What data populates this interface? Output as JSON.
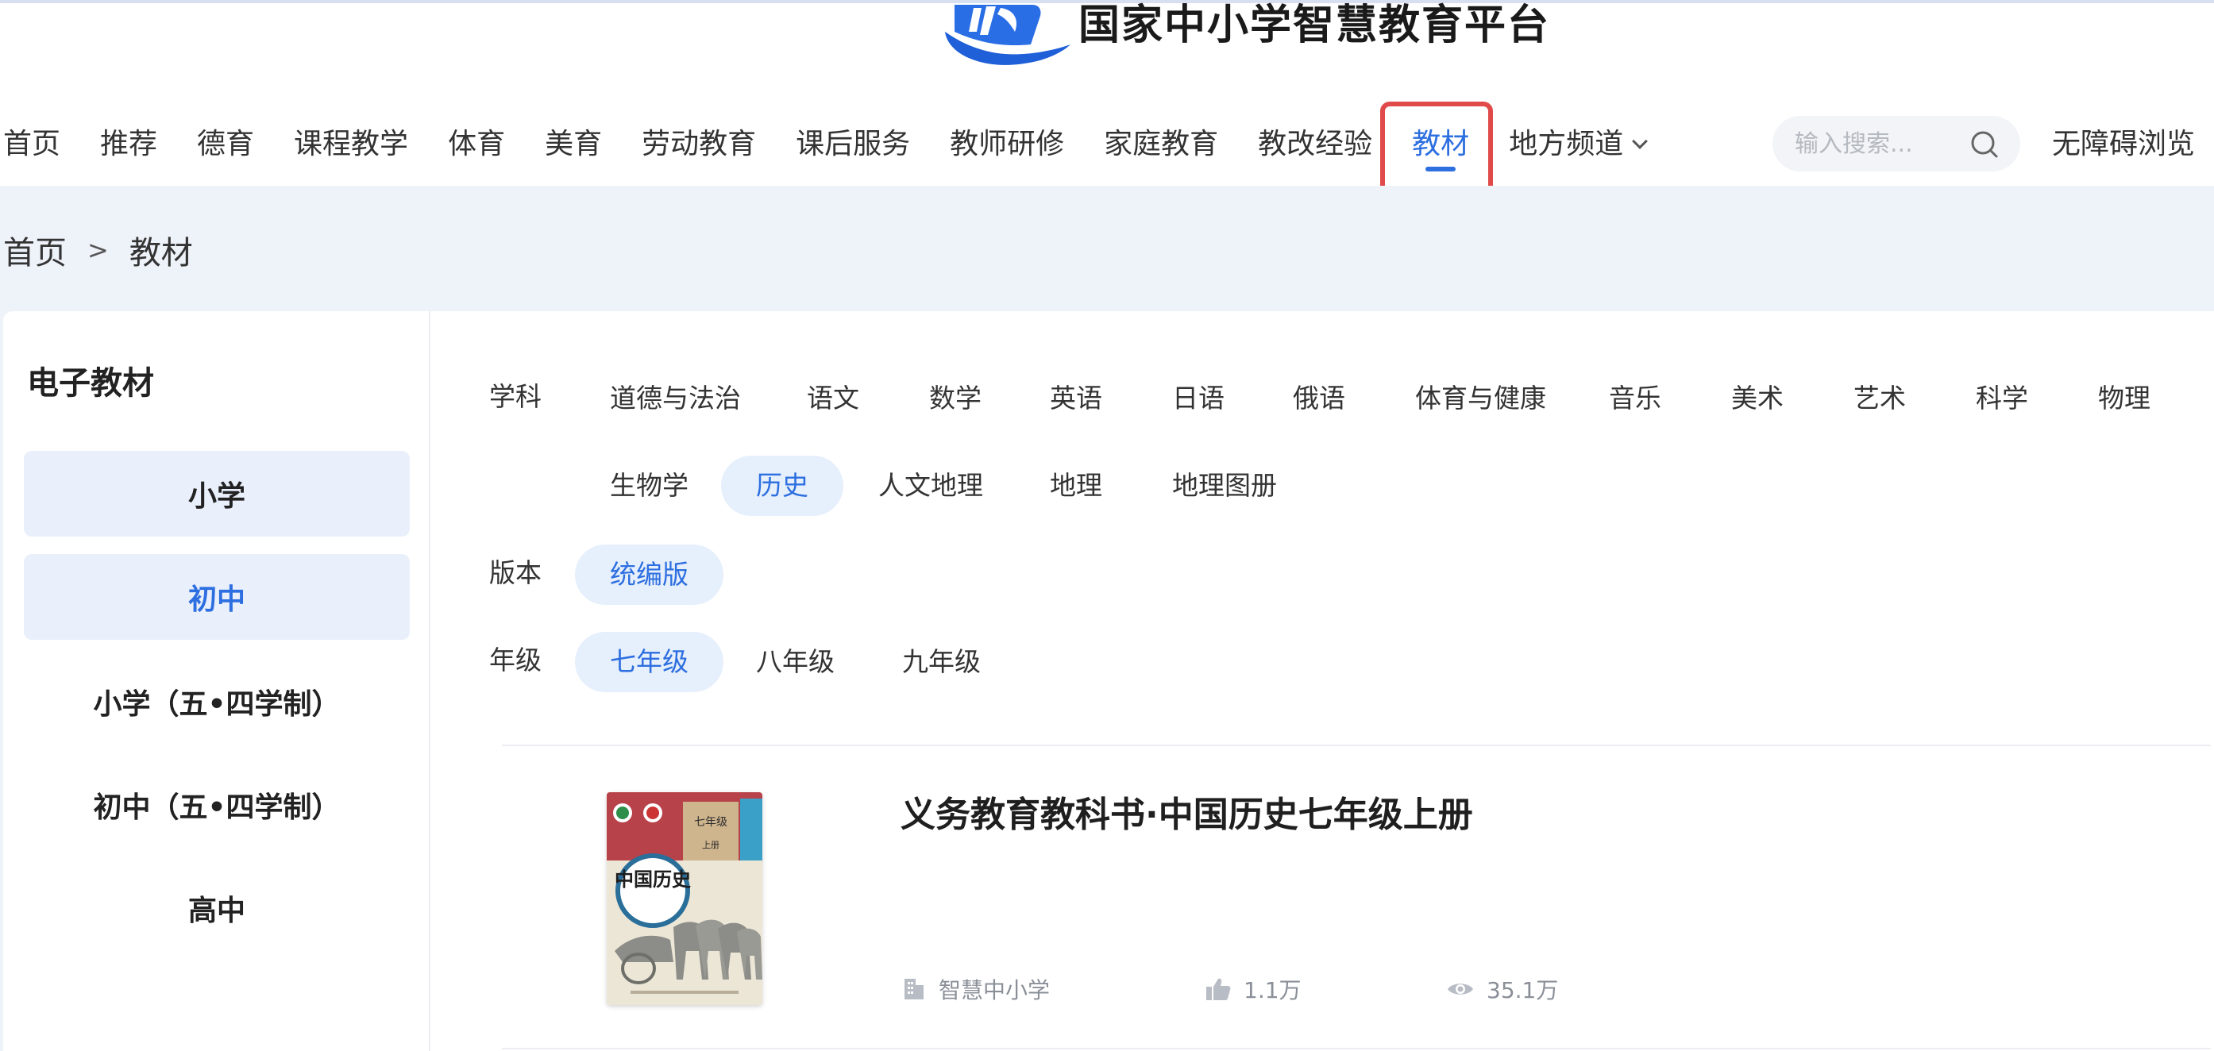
{
  "header": {
    "logo_text": "国家中小学智慧教育平台",
    "nav": [
      {
        "id": "home",
        "label": "首页"
      },
      {
        "id": "recommend",
        "label": "推荐"
      },
      {
        "id": "moral",
        "label": "德育"
      },
      {
        "id": "course",
        "label": "课程教学"
      },
      {
        "id": "sports",
        "label": "体育"
      },
      {
        "id": "arts",
        "label": "美育"
      },
      {
        "id": "labor",
        "label": "劳动教育"
      },
      {
        "id": "afterschool",
        "label": "课后服务"
      },
      {
        "id": "teacher",
        "label": "教师研修"
      },
      {
        "id": "family",
        "label": "家庭教育"
      },
      {
        "id": "reform",
        "label": "教改经验"
      },
      {
        "id": "textbook",
        "label": "教材",
        "active": true
      },
      {
        "id": "local",
        "label": "地方频道",
        "dropdown": true
      }
    ],
    "search_placeholder": "输入搜索...",
    "accessibility_label": "无障碍浏览"
  },
  "breadcrumb": {
    "home": "首页",
    "separator": ">",
    "current": "教材"
  },
  "sidebar": {
    "title": "电子教材",
    "items": [
      {
        "label": "小学",
        "shaded": true
      },
      {
        "label": "初中",
        "shaded": true,
        "active": true
      },
      {
        "label": "小学（五•四学制）"
      },
      {
        "label": "初中（五•四学制）"
      },
      {
        "label": "高中"
      }
    ]
  },
  "filters": {
    "subject_label": "学科",
    "subjects_row1": [
      "道德与法治",
      "语文",
      "数学",
      "英语",
      "日语",
      "俄语",
      "体育与健康",
      "音乐",
      "美术",
      "艺术",
      "科学",
      "物理"
    ],
    "subjects_row2": [
      "生物学",
      "历史",
      "人文地理",
      "地理",
      "地理图册"
    ],
    "selected_subject": "历史",
    "edition_label": "版本",
    "editions": [
      "统编版"
    ],
    "selected_edition": "统编版",
    "grade_label": "年级",
    "grades": [
      "七年级",
      "八年级",
      "九年级"
    ],
    "selected_grade": "七年级"
  },
  "result": {
    "title": "义务教育教科书·中国历史七年级上册",
    "cover": {
      "grade": "七年级",
      "volume": "上册",
      "subject": "中国历史"
    },
    "publisher": "智慧中小学",
    "likes": "1.1万",
    "views": "35.1万"
  },
  "colors": {
    "accent": "#2d6fe0",
    "highlight_border": "#e04a4a",
    "band_bg": "#eef2f9",
    "selected_chip_bg": "#e6effc"
  }
}
